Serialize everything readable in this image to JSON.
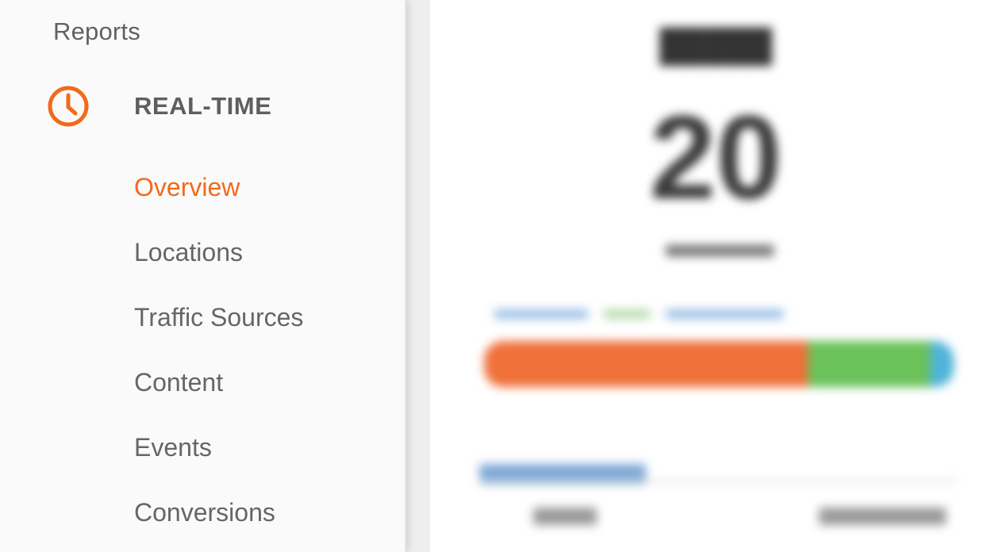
{
  "sidebar": {
    "section_title": "Reports",
    "group": {
      "label": "REAL-TIME",
      "icon": "clock-icon",
      "icon_color": "#f26a1b"
    },
    "items": [
      {
        "label": "Overview",
        "active": true
      },
      {
        "label": "Locations",
        "active": false
      },
      {
        "label": "Traffic Sources",
        "active": false
      },
      {
        "label": "Content",
        "active": false
      },
      {
        "label": "Events",
        "active": false
      },
      {
        "label": "Conversions",
        "active": false
      }
    ]
  },
  "main": {
    "blurred": true,
    "active_users_count": "20",
    "device_split": {
      "desktop_color": "#f0703a",
      "mobile_color": "#6ac259",
      "tablet_color": "#4fb3d9"
    }
  },
  "colors": {
    "accent": "#f26a1b",
    "text_muted": "#666666"
  }
}
